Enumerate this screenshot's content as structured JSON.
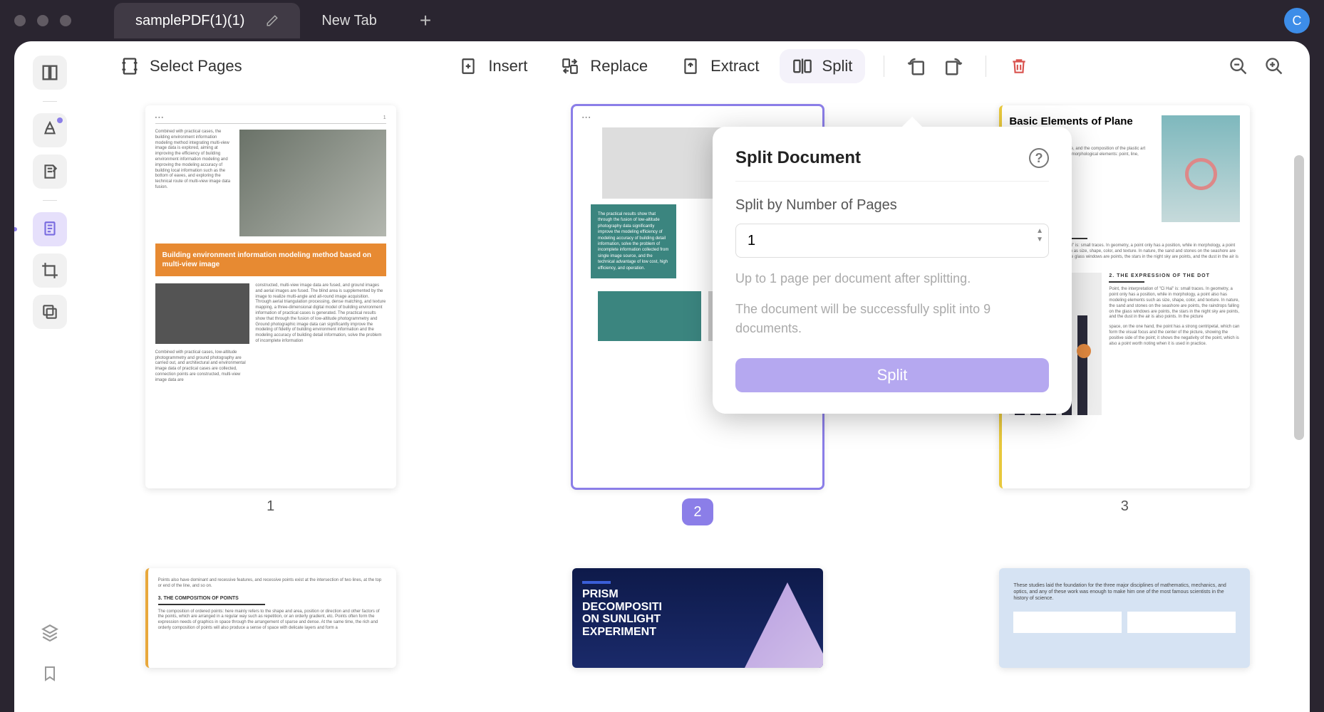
{
  "titlebar": {
    "tabs": [
      {
        "label": "samplePDF(1)(1)",
        "active": true
      },
      {
        "label": "New Tab",
        "active": false
      }
    ],
    "avatar": "C"
  },
  "toolbar": {
    "select_pages": "Select Pages",
    "insert": "Insert",
    "replace": "Replace",
    "extract": "Extract",
    "split": "Split"
  },
  "popover": {
    "title": "Split Document",
    "section_label": "Split by Number of Pages",
    "value": "1",
    "hint1": "Up to 1 page per document after splitting.",
    "hint2": "The document will be successfully split into 9 documents.",
    "action": "Split"
  },
  "pages": {
    "p1": "1",
    "p2": "2",
    "p3": "3"
  },
  "thumb1": {
    "topbar": "▪ ▪ ▪",
    "pagenum": "1",
    "para1": "Combined with practical cases, the building environment information modeling method integrating multi-view image data is explored, aiming at improving the efficiency of building environment information modeling and improving the modeling accuracy of building local information such as the bottom of eaves, and exploring the technical route of multi-view image data fusion.",
    "headline": "Building environment information modeling method based on multi-view image",
    "para2": "constructed, multi-view image data are fused, and ground images and aerial images are fused. The blind area is supplemented by the image to realize multi-angle and all-round image acquisition. Through aerial triangulation processing, dense matching, and texture mapping, a three-dimensional digital model of building environment information of practical cases is generated. The practical results show that through the fusion of low-altitude photogrammetry and Ground photographic image data can significantly improve the modeling of fidelity of building environment information and the modeling accuracy of building detail information, solve the problem of incomplete information",
    "para3": "Combined with practical cases, low-altitude photogrammetry and ground photography are carried out, and architectural and environmental image data of practical cases are collected, connection points are constructed, multi-view image data are"
  },
  "thumb2": {
    "para": "The practical results show that through the fusion of low-altitude photography data significantly improve the modeling efficiency of modeling accuracy of building detail information, solve the problem of incomplete information collected from single image source, and the technical advantage of low cost, high efficiency, and operation."
  },
  "thumb3": {
    "title": "Basic Elements of Plane Space",
    "intro": "Any art contains its own language, and the composition of the plastic art language is mainly composed of morphological elements: point, line, surface, body, color and texture.",
    "h1": "1. KNOW THE POINTS",
    "p1": "Point, the interpretation of \"Ci Hai\" is: small traces. In geometry, a point only has a position, while in morphology, a point also has modeling elements such as size, shape, color, and texture. In nature, the sand and stones on the seashore are points, the raindrops falling on the glass windows are points, the stars in the night sky are points, and the dust in the air is also points.",
    "h2": "2. THE EXPRESSION OF THE DOT",
    "p2": "Point, the interpretation of \"Ci Hai\" is: small traces. In geometry, a point only has a position, while in morphology, a point also has modeling elements such as size, shape, color, and texture. In nature, the sand and stones on the seashore are points, the raindrops falling on the glass windows are points, the stars in the night sky are points, and the dust in the air is also points. In the picture",
    "p3": "space, on the one hand, the point has a strong centripetal, which can form the visual focus and the center of the picture, showing the positive side of the point; it shows the negativity of the point, which is also a point worth noting when it is used in practice."
  },
  "thumb4": {
    "intro": "Points also have dominant and recessive features, and recessive points exist at the intersection of two lines, at the top or end of the line, and so on.",
    "h": "3. THE COMPOSITION OF POINTS",
    "p": "The composition of ordered points: here mainly refers to the shape and area, position or direction and other factors of the points, which are arranged in a regular way such as repetition, or an orderly gradient, etc. Points often form the expression needs of graphics in space through the arrangement of sparse and dense. At the same time, the rich and orderly composition of points will also produce a sense of space with delicate layers and form a"
  },
  "thumb5": {
    "title1": "PRISM",
    "title2": "DECOMPOSITI",
    "title3": "ON SUNLIGHT",
    "title4": "EXPERIMENT"
  },
  "thumb6": {
    "p": "These studies laid the foundation for the three major disciplines of mathematics, mechanics, and optics, and any of these work was enough to make him one of the most famous scientists in the history of science."
  }
}
